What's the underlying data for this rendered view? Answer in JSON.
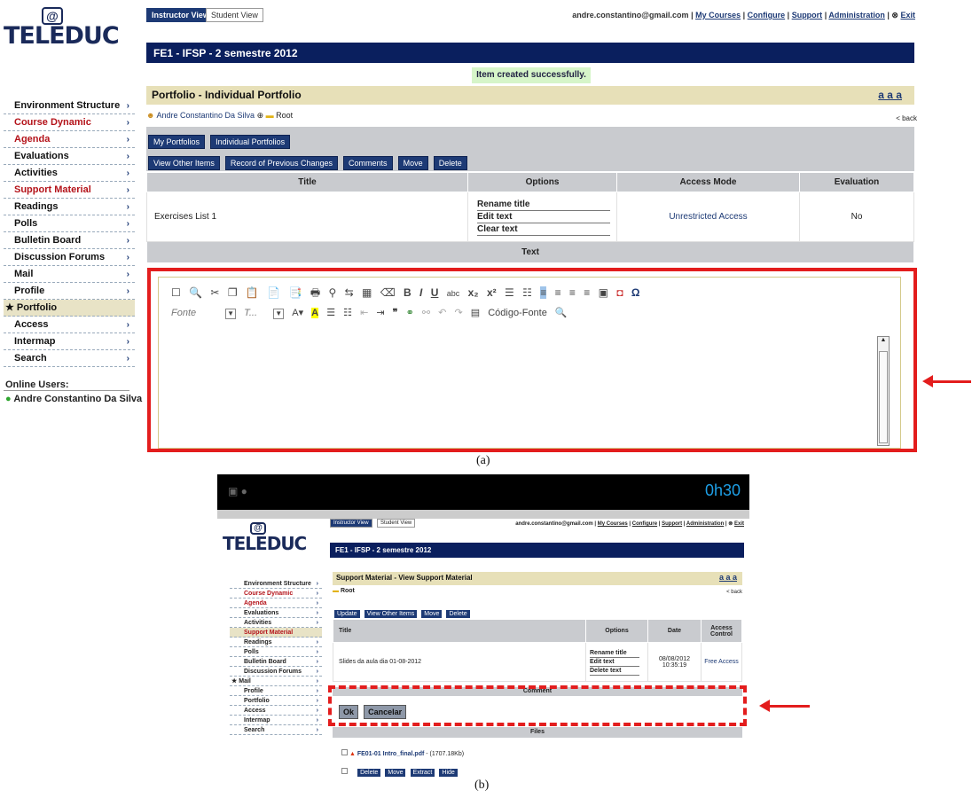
{
  "panel_a": {
    "logo": "TELEDUC",
    "view_tabs": [
      "Instructor View",
      "Student View"
    ],
    "user_email": "andre.constantino@gmail.com",
    "top_links": [
      "My Courses",
      "Configure",
      "Support",
      "Administration"
    ],
    "exit_label": "Exit",
    "course_title": "FE1 - IFSP - 2 semestre 2012",
    "success_message": "Item created successfully.",
    "section_title": "Portfolio - Individual Portfolio",
    "font_size_links": "a a a",
    "breadcrumb_user": "Andre Constantino Da Silva",
    "breadcrumb_root": "Root",
    "back_label": "< back",
    "menu": [
      {
        "label": "Environment Structure",
        "color": "black"
      },
      {
        "label": "Course Dynamic",
        "color": "red"
      },
      {
        "label": "Agenda",
        "color": "red"
      },
      {
        "label": "Evaluations",
        "color": "black"
      },
      {
        "label": "Activities",
        "color": "black"
      },
      {
        "label": "Support Material",
        "color": "red"
      },
      {
        "label": "Readings",
        "color": "black"
      },
      {
        "label": "Polls",
        "color": "black"
      },
      {
        "label": "Bulletin Board",
        "color": "black"
      },
      {
        "label": "Discussion Forums",
        "color": "black"
      },
      {
        "label": "Mail",
        "color": "black"
      },
      {
        "label": "Profile",
        "color": "black"
      },
      {
        "label": "Portfolio",
        "color": "selected"
      },
      {
        "label": "Access",
        "color": "black"
      },
      {
        "label": "Intermap",
        "color": "black"
      },
      {
        "label": "Search",
        "color": "black"
      }
    ],
    "online_users_label": "Online Users:",
    "online_user": "Andre Constantino Da Silva",
    "portfolio_buttons": [
      "My Portfolios",
      "Individual Portfolios"
    ],
    "action_buttons": [
      "View Other Items",
      "Record of Previous Changes",
      "Comments",
      "Move",
      "Delete"
    ],
    "table": {
      "headers": [
        "Title",
        "Options",
        "Access Mode",
        "Evaluation"
      ],
      "row": {
        "title": "Exercises List 1",
        "options": [
          "Rename title",
          "Edit text",
          "Clear text"
        ],
        "access": "Unrestricted Access",
        "evaluation": "No"
      }
    },
    "text_header": "Text",
    "editor": {
      "font_placeholder": "Fonte",
      "size_placeholder": "T...",
      "source_button": "Código-Fonte"
    },
    "caption": "(a)"
  },
  "panel_b": {
    "clock": "0h30",
    "logo": "TELEDUC",
    "view_tabs": [
      "Instructor View",
      "Student View"
    ],
    "user_email": "andre.constantino@gmail.com",
    "top_links": [
      "My Courses",
      "Configure",
      "Support",
      "Administration"
    ],
    "exit_label": "Exit",
    "course_title": "FE1 - IFSP - 2 semestre 2012",
    "section_title": "Support Material - View Support Material",
    "font_size_links": "a a a",
    "breadcrumb_root": "Root",
    "back_label": "< back",
    "menu": [
      {
        "label": "Environment Structure",
        "color": "black"
      },
      {
        "label": "Course Dynamic",
        "color": "red"
      },
      {
        "label": "Agenda",
        "color": "red"
      },
      {
        "label": "Evaluations",
        "color": "black"
      },
      {
        "label": "Activities",
        "color": "black"
      },
      {
        "label": "Support Material",
        "color": "selected"
      },
      {
        "label": "Readings",
        "color": "black"
      },
      {
        "label": "Polls",
        "color": "black"
      },
      {
        "label": "Bulletin Board",
        "color": "black"
      },
      {
        "label": "Discussion Forums",
        "color": "black"
      },
      {
        "label": "Mail",
        "color": "black"
      },
      {
        "label": "Profile",
        "color": "black"
      },
      {
        "label": "Portfolio",
        "color": "black"
      },
      {
        "label": "Access",
        "color": "black"
      },
      {
        "label": "Intermap",
        "color": "black"
      },
      {
        "label": "Search",
        "color": "black"
      }
    ],
    "action_buttons": [
      "Update",
      "View Other Items",
      "Move",
      "Delete"
    ],
    "table": {
      "headers": [
        "Title",
        "Options",
        "Date",
        "Access Control"
      ],
      "row": {
        "title": "Slides da aula dia 01-08-2012",
        "options": [
          "Rename title",
          "Edit text",
          "Delete text"
        ],
        "date": "08/08/2012 10:35:19",
        "access": "Free Access"
      }
    },
    "comment_header": "Comment",
    "comment_buttons": [
      "Ok",
      "Cancelar"
    ],
    "files_header": "Files",
    "file_name": "FE01-01 Intro_final.pdf",
    "file_size": " - (1707.18Kb)",
    "file_buttons": [
      "Delete",
      "Move",
      "Extract",
      "Hide"
    ],
    "caption": "(b)"
  }
}
